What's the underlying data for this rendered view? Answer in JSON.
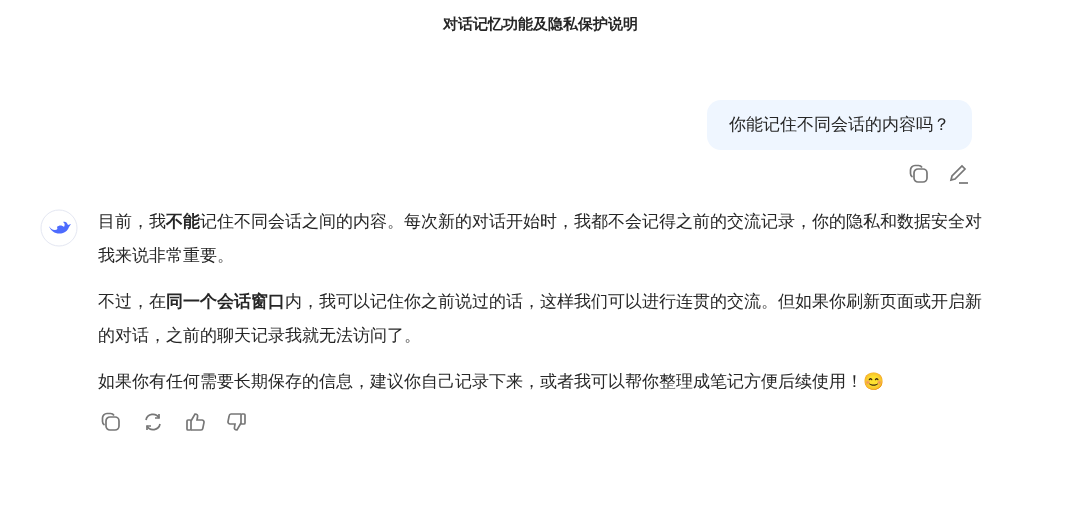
{
  "title": "对话记忆功能及隐私保护说明",
  "user_message": {
    "text": "你能记住不同会话的内容吗？"
  },
  "assistant_message": {
    "paragraphs": [
      "目前，我**不能**记住不同会话之间的内容。每次新的对话开始时，我都不会记得之前的交流记录，你的隐私和数据安全对我来说非常重要。",
      "不过，在**同一个会话窗口**内，我可以记住你之前说过的话，这样我们可以进行连贯的交流。但如果你刷新页面或开启新的对话，之前的聊天记录我就无法访问了。",
      "如果你有任何需要长期保存的信息，建议你自己记录下来，或者我可以帮你整理成笔记方便后续使用！😊"
    ]
  }
}
